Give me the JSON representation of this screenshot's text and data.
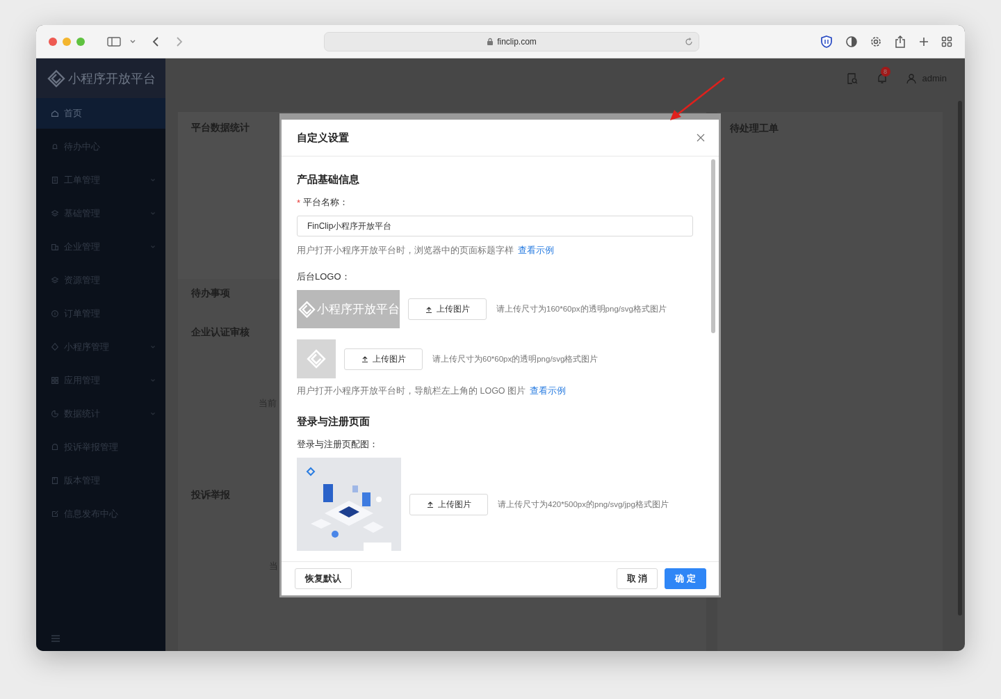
{
  "browser": {
    "url": "finclip.com"
  },
  "sidebar": {
    "title": "小程序开放平台",
    "items": [
      {
        "label": "首页",
        "selected": true,
        "expandable": false
      },
      {
        "label": "待办中心",
        "selected": false,
        "expandable": false
      },
      {
        "label": "工单管理",
        "selected": false,
        "expandable": true
      },
      {
        "label": "基础管理",
        "selected": false,
        "expandable": true
      },
      {
        "label": "企业管理",
        "selected": false,
        "expandable": true
      },
      {
        "label": "资源管理",
        "selected": false,
        "expandable": false
      },
      {
        "label": "订单管理",
        "selected": false,
        "expandable": false
      },
      {
        "label": "小程序管理",
        "selected": false,
        "expandable": true
      },
      {
        "label": "应用管理",
        "selected": false,
        "expandable": true
      },
      {
        "label": "数据统计",
        "selected": false,
        "expandable": true
      },
      {
        "label": "投诉举报管理",
        "selected": false,
        "expandable": false
      },
      {
        "label": "版本管理",
        "selected": false,
        "expandable": false
      },
      {
        "label": "信息发布中心",
        "selected": false,
        "expandable": false
      }
    ]
  },
  "header": {
    "notification_badge": "8",
    "user": "admin"
  },
  "dashboard": {
    "left_sections": [
      {
        "title": "平台数据统计"
      },
      {
        "title": "待办事项"
      },
      {
        "title": "企业认证审核",
        "note": "当前"
      },
      {
        "title": "投诉举报",
        "note": "当"
      }
    ],
    "right_card": {
      "title": "待处理工单"
    }
  },
  "modal": {
    "title": "自定义设置",
    "sections": [
      {
        "title": "产品基础信息",
        "fields": [
          {
            "kind": "text",
            "required_mark": "*",
            "label": "平台名称：",
            "value": "FinClip小程序开放平台",
            "hint": "用户打开小程序开放平台时，浏览器中的页面标题字样",
            "link": "查看示例"
          },
          {
            "kind": "upload",
            "label": "后台LOGO：",
            "uploads": [
              {
                "kind": "wide",
                "preview_text": "小程序开放平台",
                "button": "上传图片",
                "hint": "请上传尺寸为160*60px的透明png/svg格式图片"
              },
              {
                "kind": "square",
                "button": "上传图片",
                "hint": "请上传尺寸为60*60px的透明png/svg格式图片"
              }
            ],
            "hint": "用户打开小程序开放平台时，导航栏左上角的 LOGO 图片",
            "link": "查看示例"
          }
        ]
      },
      {
        "title": "登录与注册页面",
        "fields": [
          {
            "kind": "upload",
            "label": "登录与注册页配图：",
            "uploads": [
              {
                "kind": "picture",
                "button": "上传图片",
                "hint": "请上传尺寸为420*500px的png/svg/jpg格式图片"
              }
            ]
          }
        ]
      }
    ],
    "footer": {
      "reset": "恢复默认",
      "cancel": "取 消",
      "confirm": "确 定"
    }
  }
}
